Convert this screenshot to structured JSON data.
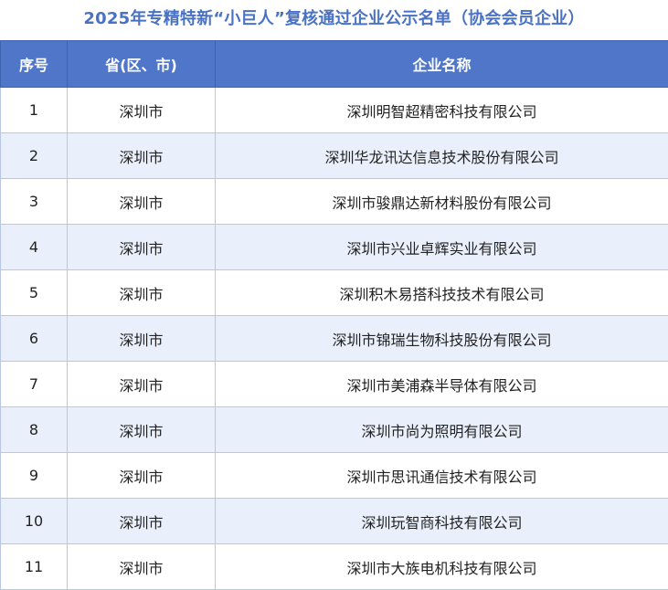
{
  "title": "2025年专精特新“小巨人”复核通过企业公示名单（协会会员企业）",
  "table": {
    "headers": [
      "序号",
      "省(区、市)",
      "企业名称"
    ],
    "rows": [
      [
        "1",
        "深圳市",
        "深圳明智超精密科技有限公司"
      ],
      [
        "2",
        "深圳市",
        "深圳华龙讯达信息技术股份有限公司"
      ],
      [
        "3",
        "深圳市",
        "深圳市骏鼎达新材料股份有限公司"
      ],
      [
        "4",
        "深圳市",
        "深圳市兴业卓辉实业有限公司"
      ],
      [
        "5",
        "深圳市",
        "深圳积木易搭科技技术有限公司"
      ],
      [
        "6",
        "深圳市",
        "深圳市锦瑞生物科技股份有限公司"
      ],
      [
        "7",
        "深圳市",
        "深圳市美浦森半导体有限公司"
      ],
      [
        "8",
        "深圳市",
        "深圳市尚为照明有限公司"
      ],
      [
        "9",
        "深圳市",
        "深圳市思讯通信技术有限公司"
      ],
      [
        "10",
        "深圳市",
        "深圳玩智商科技有限公司"
      ],
      [
        "11",
        "深圳市",
        "深圳市大族电机科技有限公司"
      ]
    ]
  },
  "colors": {
    "title": "#4a72c4",
    "header_bg": "#4f76c8",
    "stripe_bg": "#eaf0fb",
    "border": "#b9c6e4"
  }
}
